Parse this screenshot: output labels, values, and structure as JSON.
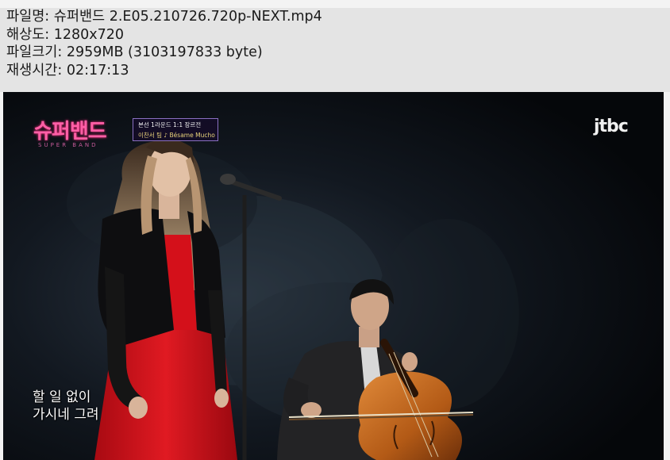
{
  "file_info": {
    "filename": "파일명: 슈퍼밴드 2.E05.210726.720p-NEXT.mp4",
    "resolution": "해상도: 1280x720",
    "filesize": "파일크기: 2959MB (3103197833 byte)",
    "duration": "재생시간: 02:17:13"
  },
  "video": {
    "show_logo": "슈퍼밴드",
    "show_logo_sub": "SUPER BAND",
    "episode_line1": "본선 1라운드 1:1 장르전",
    "episode_line2": "이찬서 팀 ♪ Bésame Mucho",
    "channel_logo": "jtbc",
    "subtitle_line1": "할 일 없이",
    "subtitle_line2": "가시네 그려"
  },
  "colors": {
    "panel_bg": "#e4e4e4",
    "dress_red": "#d4101a",
    "cello": "#b8621c"
  }
}
